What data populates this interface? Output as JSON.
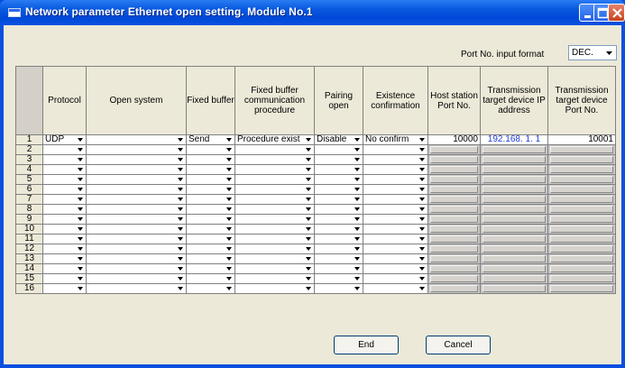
{
  "window": {
    "title": "Network parameter Ethernet open setting. Module No.1"
  },
  "port_format": {
    "label": "Port No. input format",
    "value": "DEC."
  },
  "columns": [
    "Protocol",
    "Open system",
    "Fixed buffer",
    "Fixed buffer communication procedure",
    "Pairing open",
    "Existence confirmation",
    "Host station Port No.",
    "Transmission target device IP address",
    "Transmission target device Port No."
  ],
  "rows": [
    {
      "no": "1",
      "protocol": "UDP",
      "open_system": "",
      "fixed_buffer": "Send",
      "procedure": "Procedure exist",
      "pairing": "Disable",
      "existence": "No confirm",
      "host_port": "10000",
      "target_ip": "192.168.  1.  1",
      "target_port": "10001"
    },
    {
      "no": "2"
    },
    {
      "no": "3"
    },
    {
      "no": "4"
    },
    {
      "no": "5"
    },
    {
      "no": "6"
    },
    {
      "no": "7"
    },
    {
      "no": "8"
    },
    {
      "no": "9"
    },
    {
      "no": "10"
    },
    {
      "no": "11"
    },
    {
      "no": "12"
    },
    {
      "no": "13"
    },
    {
      "no": "14"
    },
    {
      "no": "15"
    },
    {
      "no": "16"
    }
  ],
  "buttons": {
    "end": "End",
    "cancel": "Cancel"
  }
}
